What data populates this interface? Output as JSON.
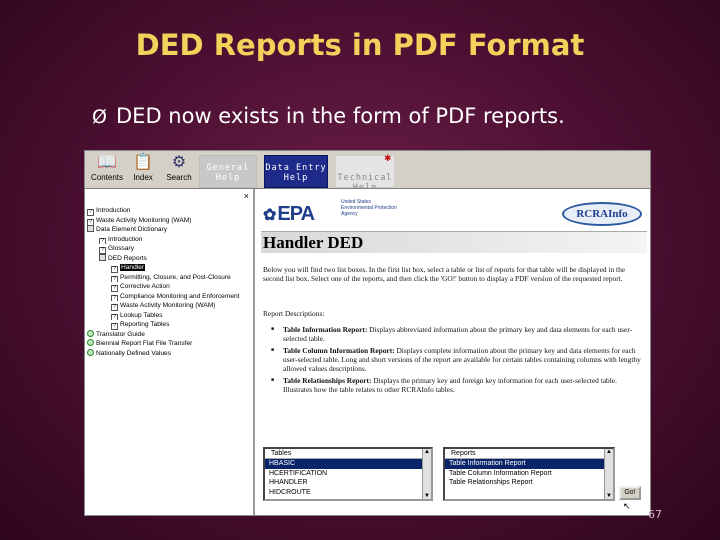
{
  "slide": {
    "title": "DED Reports in PDF Format",
    "bullet_arrow": "Ø",
    "bullet_text": "DED now exists in the form of PDF reports.",
    "page_number": "67"
  },
  "toolbar": {
    "tools": [
      {
        "label": "Contents",
        "icon": "book-icon",
        "glyph": "📖"
      },
      {
        "label": "Index",
        "icon": "index-icon",
        "glyph": "📋"
      },
      {
        "label": "Search",
        "icon": "search-gear-icon",
        "glyph": "⚙"
      }
    ],
    "tabs": {
      "general": "General\nHelp",
      "data_entry": "Data Entry\nHelp",
      "technical": "Technical\nHelp"
    },
    "star": "✱"
  },
  "left_pane": {
    "close": "×",
    "tree": [
      {
        "label": "Introduction",
        "indent": 0,
        "icon": "page"
      },
      {
        "label": "Waste Activity Monitoring (WAM)",
        "indent": 0,
        "icon": "page"
      },
      {
        "label": "Data Element Dictionary",
        "indent": 0,
        "icon": "book"
      },
      {
        "label": "Introduction",
        "indent": 1,
        "icon": "page"
      },
      {
        "label": "Glossary",
        "indent": 1,
        "icon": "page"
      },
      {
        "label": "DED Reports",
        "indent": 1,
        "icon": "book"
      },
      {
        "label": "Handler",
        "indent": 2,
        "icon": "page",
        "active": true
      },
      {
        "label": "Permitting, Closure, and Post-Closure",
        "indent": 2,
        "icon": "page"
      },
      {
        "label": "Corrective Action",
        "indent": 2,
        "icon": "page"
      },
      {
        "label": "Compliance Monitoring and Enforcement",
        "indent": 2,
        "icon": "page"
      },
      {
        "label": "Waste Activity Monitoring (WAM)",
        "indent": 2,
        "icon": "page"
      },
      {
        "label": "Lookup Tables",
        "indent": 2,
        "icon": "page"
      },
      {
        "label": "Reporting Tables",
        "indent": 2,
        "icon": "page"
      },
      {
        "label": "Translator Guide",
        "indent": 0,
        "icon": "green"
      },
      {
        "label": "Biennial Report Flat File Transfer",
        "indent": 0,
        "icon": "green"
      },
      {
        "label": "Nationally Defined Values",
        "indent": 0,
        "icon": "green"
      }
    ]
  },
  "content": {
    "epa_logo": "EPA",
    "epa_agency": "United States Environmental Protection Agency",
    "rcra_logo": "RCRAInfo",
    "heading": "Handler DED",
    "intro": "Below you will find two list boxes. In the first list box, select a table or list of reports for that table will be displayed in the second list box. Select one of the reports, and then click the 'GO!' button to display a PDF version of the requested report.",
    "descriptions_label": "Report Descriptions:",
    "descriptions": [
      {
        "title": "Table Information Report:",
        "text": " Displays abbreviated information about the primary key and data elements for each user-selected table."
      },
      {
        "title": "Table Column Information Report:",
        "text": " Displays complete information about the primary key and data elements for each user-selected table. Long and short versions of the report are available for certain tables containing columns with lengthy allowed values descriptions."
      },
      {
        "title": "Table Relationships Report:",
        "text": " Displays the primary key and foreign key information for each user-selected table. Illustrates how the table relates to other RCRAInfo tables."
      }
    ],
    "tables_list": {
      "header": "Tables",
      "rows": [
        "HBASIC",
        "HCERTIFICATION",
        "HHANDLER",
        "HIDCROUTE"
      ],
      "selected_index": 0
    },
    "reports_list": {
      "header": "Reports",
      "rows": [
        "Table Information Report",
        "Table Column Information Report",
        "Table Relationships Report"
      ],
      "selected_index": 0
    },
    "go_button": "Go!",
    "cursor": "↖"
  }
}
